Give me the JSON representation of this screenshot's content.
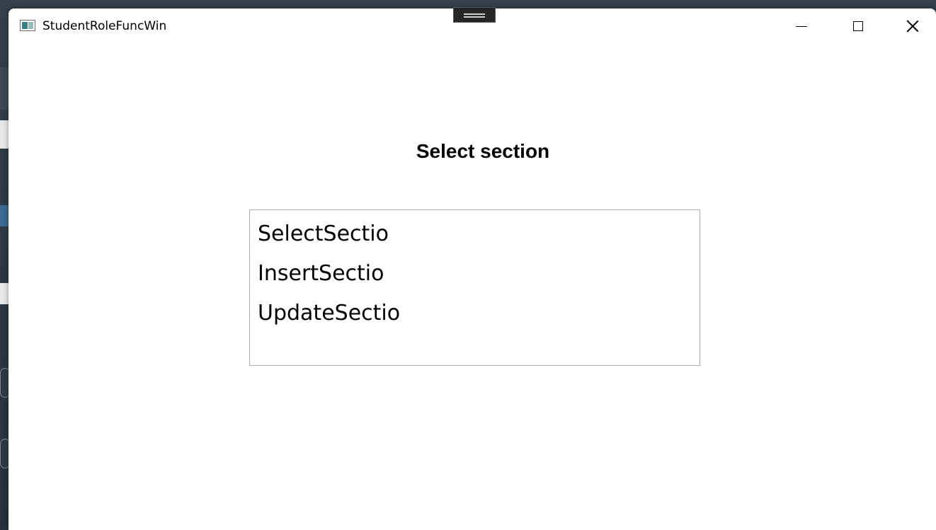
{
  "window": {
    "title": "StudentRoleFuncWin",
    "icon": "app-window-icon"
  },
  "caption_buttons": {
    "minimize": "minimize-icon",
    "maximize": "maximize-icon",
    "close": "close-icon"
  },
  "main": {
    "heading": "Select section",
    "list_items": [
      {
        "label": "SelectSectio"
      },
      {
        "label": "InsertSectio"
      },
      {
        "label": "UpdateSectio"
      }
    ]
  }
}
